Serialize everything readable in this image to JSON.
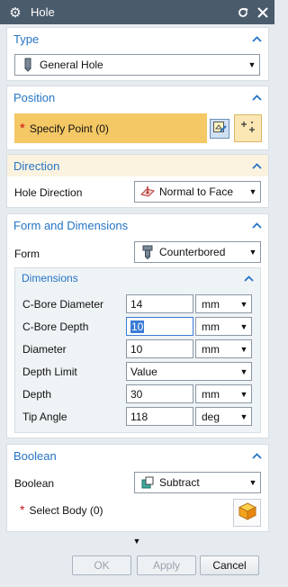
{
  "window": {
    "title": "Hole",
    "reset_icon": "reset-icon",
    "close_icon": "close-icon"
  },
  "type_section": {
    "header": "Type",
    "value": "General Hole"
  },
  "position_section": {
    "header": "Position",
    "required_mark": "*",
    "specify_point_label": "Specify Point (0)"
  },
  "direction_section": {
    "header": "Direction",
    "hole_direction_label": "Hole Direction",
    "hole_direction_value": "Normal to Face"
  },
  "form_section": {
    "header": "Form and Dimensions",
    "form_label": "Form",
    "form_value": "Counterbored"
  },
  "dimensions_section": {
    "header": "Dimensions",
    "rows": [
      {
        "label": "C-Bore Diameter",
        "value": "14",
        "unit": "mm"
      },
      {
        "label": "C-Bore Depth",
        "value": "10",
        "unit": "mm"
      },
      {
        "label": "Diameter",
        "value": "10",
        "unit": "mm"
      },
      {
        "label": "Depth Limit",
        "value": "Value"
      },
      {
        "label": "Depth",
        "value": "30",
        "unit": "mm"
      },
      {
        "label": "Tip Angle",
        "value": "118",
        "unit": "deg"
      }
    ]
  },
  "boolean_section": {
    "header": "Boolean",
    "boolean_label": "Boolean",
    "boolean_value": "Subtract",
    "required_mark": "*",
    "select_body_label": "Select Body (0)"
  },
  "buttons": {
    "ok": "OK",
    "apply": "Apply",
    "cancel": "Cancel"
  },
  "colors": {
    "titlebar": "#4a5b6c",
    "accent": "#2574c4",
    "required_field_bg": "#f5c866",
    "required_mark": "#d0121b"
  }
}
